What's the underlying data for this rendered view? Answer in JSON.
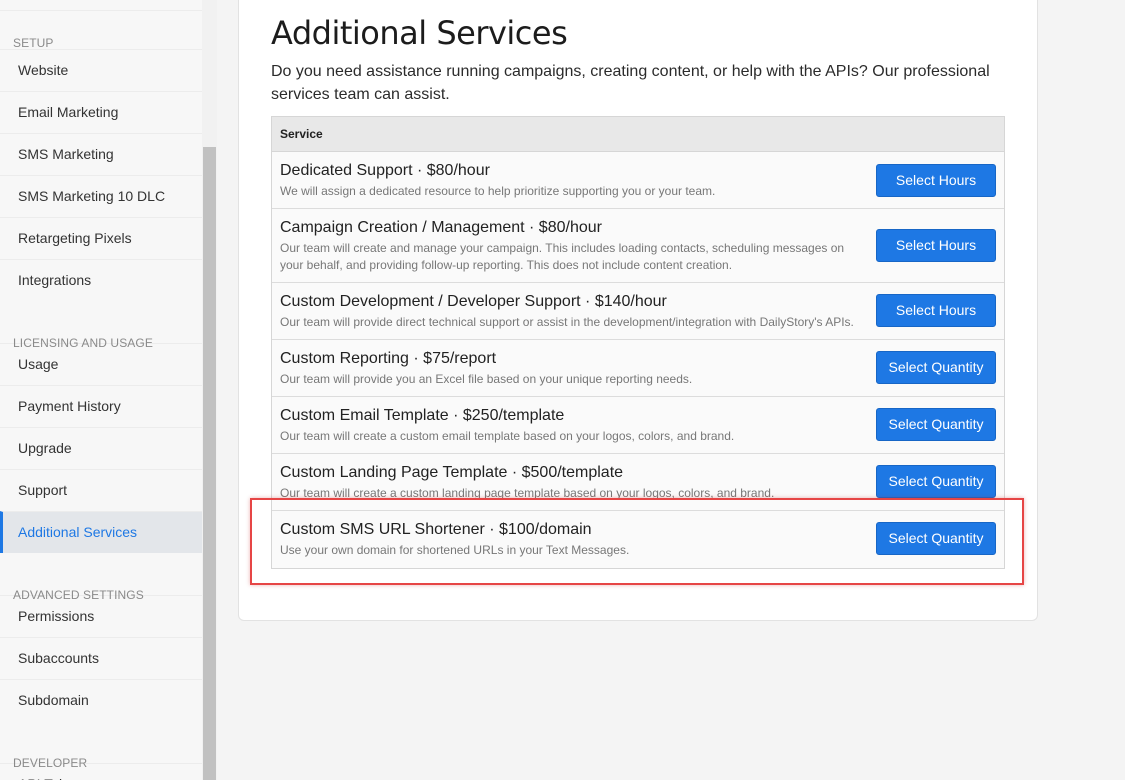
{
  "sidebar": {
    "sections": [
      {
        "title": "SETUP",
        "items": [
          "Website",
          "Email Marketing",
          "SMS Marketing",
          "SMS Marketing 10 DLC",
          "Retargeting Pixels",
          "Integrations"
        ]
      },
      {
        "title": "LICENSING AND USAGE",
        "items": [
          "Usage",
          "Payment History",
          "Upgrade",
          "Support",
          "Additional Services"
        ]
      },
      {
        "title": "ADVANCED SETTINGS",
        "items": [
          "Permissions",
          "Subaccounts",
          "Subdomain"
        ]
      },
      {
        "title": "DEVELOPER",
        "items": [
          "API Tokens"
        ]
      }
    ],
    "active_item": "Additional Services",
    "accent_color": "#1e78e4"
  },
  "main": {
    "title": "Additional Services",
    "intro": "Do you need assistance running campaigns, creating content, or help with the APIs? Our professional services team can assist.",
    "table": {
      "header": "Service",
      "rows": [
        {
          "name": "Dedicated Support · $80/hour",
          "desc": "We will assign a dedicated resource to help prioritize supporting you or your team.",
          "button": "Select Hours"
        },
        {
          "name": "Campaign Creation / Management · $80/hour",
          "desc": "Our team will create and manage your campaign. This includes loading contacts, scheduling messages on your behalf, and providing follow-up reporting. This does not include content creation.",
          "button": "Select Hours"
        },
        {
          "name": "Custom Development / Developer Support · $140/hour",
          "desc": "Our team will provide direct technical support or assist in the development/integration with DailyStory's APIs.",
          "button": "Select Hours"
        },
        {
          "name": "Custom Reporting · $75/report",
          "desc": "Our team will provide you an Excel file based on your unique reporting needs.",
          "button": "Select Quantity"
        },
        {
          "name": "Custom Email Template · $250/template",
          "desc": "Our team will create a custom email template based on your logos, colors, and brand.",
          "button": "Select Quantity"
        },
        {
          "name": "Custom Landing Page Template · $500/template",
          "desc": "Our team will create a custom landing page template based on your logos, colors, and brand.",
          "button": "Select Quantity"
        },
        {
          "name": "Custom SMS URL Shortener · $100/domain",
          "desc": "Use your own domain for shortened URLs in your Text Messages.",
          "button": "Select Quantity"
        }
      ]
    },
    "highlight_color": "#e64545"
  }
}
